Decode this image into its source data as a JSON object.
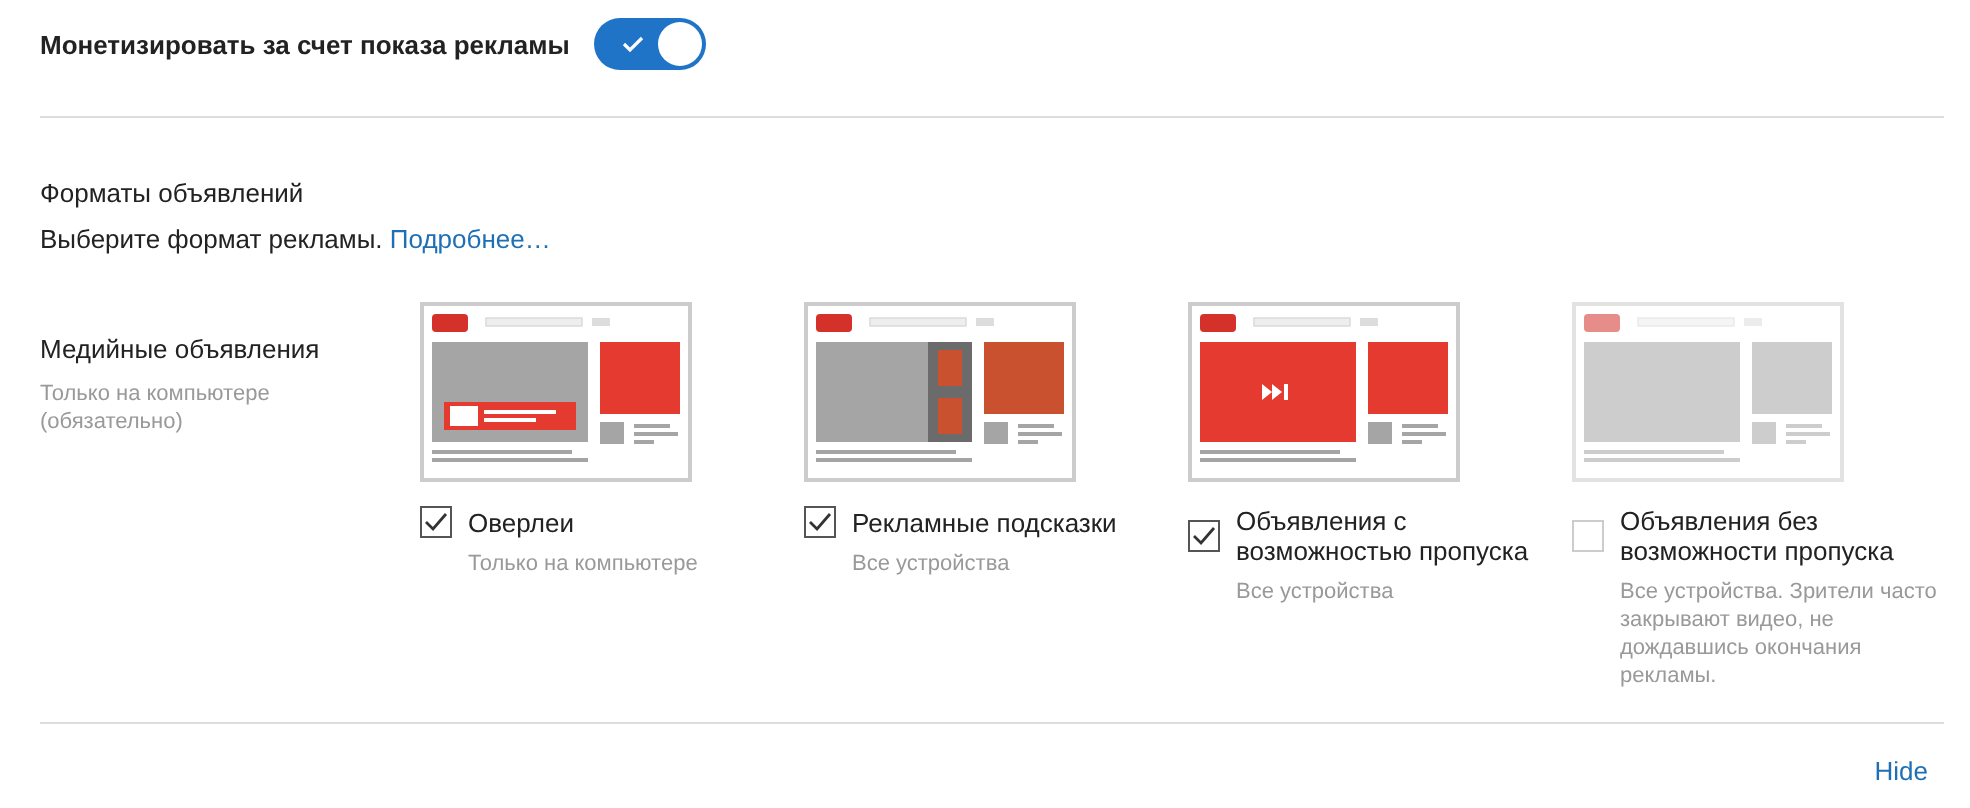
{
  "monetize": {
    "label": "Монетизировать за счет показа рекламы",
    "on": true
  },
  "formats": {
    "title": "Форматы объявлений",
    "description": "Выберите формат рекламы.",
    "link": "Подробнее…"
  },
  "display_ads": {
    "title": "Медийные объявления",
    "note": "Только на компьютере (обязательно)",
    "options": [
      {
        "kind": "overlay",
        "label": "Оверлеи",
        "note": "Только на компьютере",
        "checked": true
      },
      {
        "kind": "cards",
        "label": "Рекламные подсказки",
        "note": "Все устройства",
        "checked": true
      },
      {
        "kind": "skippable",
        "label": "Объявления с возможностью пропуска",
        "note": "Все устройства",
        "checked": true
      },
      {
        "kind": "nonskippable",
        "label": "Объявления без возможности пропуска",
        "note": "Все устройства. Зрители часто закрывают видео, не дождавшись окончания рекламы.",
        "checked": false
      }
    ]
  },
  "hide_link": "Hide"
}
